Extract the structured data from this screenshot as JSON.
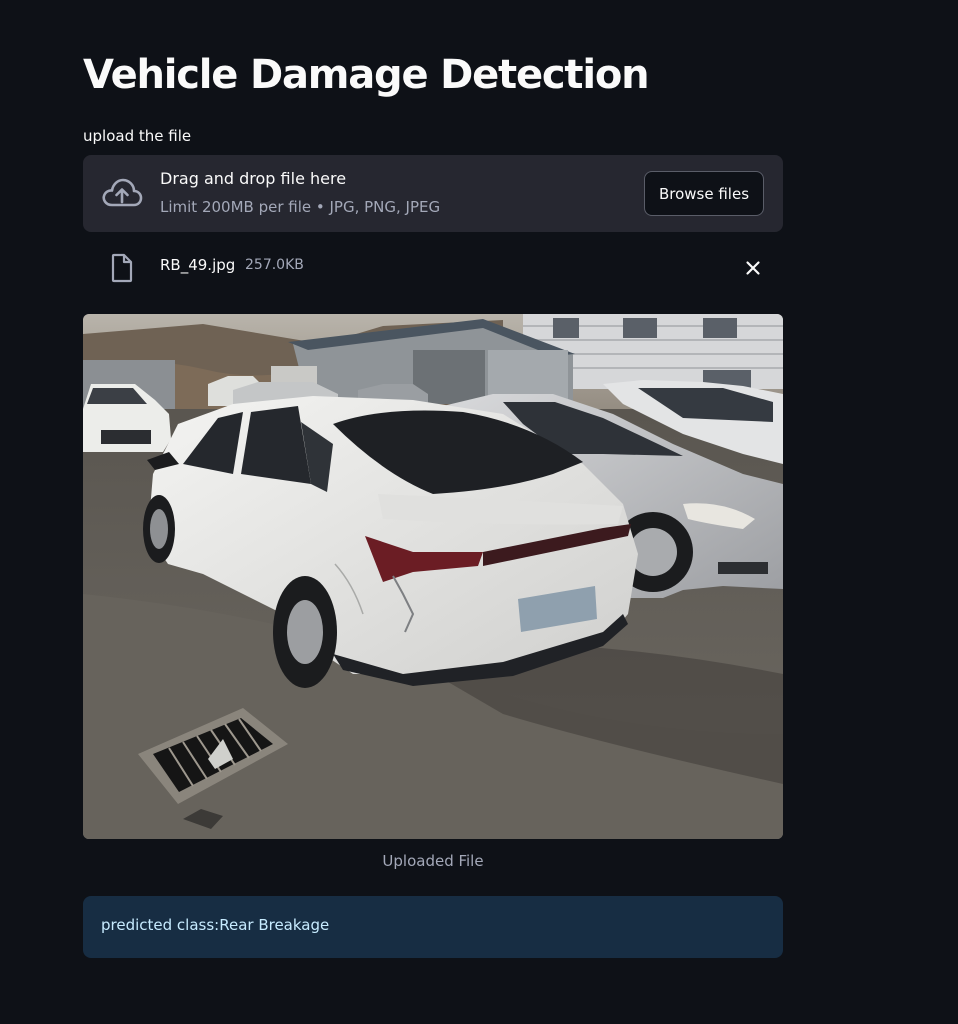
{
  "page": {
    "title": "Vehicle Damage Detection"
  },
  "uploader": {
    "label": "upload the file",
    "drop_title": "Drag and drop file here",
    "drop_limit": "Limit 200MB per file • JPG, PNG, JPEG",
    "browse_label": "Browse files",
    "icon": "cloud-upload-icon"
  },
  "uploaded_file": {
    "name": "RB_49.jpg",
    "size": "257.0KB",
    "icon": "file-icon",
    "remove_icon": "close-icon"
  },
  "image": {
    "caption": "Uploaded File"
  },
  "result": {
    "text": "predicted class:Rear Breakage"
  },
  "colors": {
    "background": "#0e1117",
    "dropzone": "#262730",
    "alert_bg": "#172d43",
    "alert_text": "#c7ebff",
    "muted_text": "#a3a8b8"
  }
}
